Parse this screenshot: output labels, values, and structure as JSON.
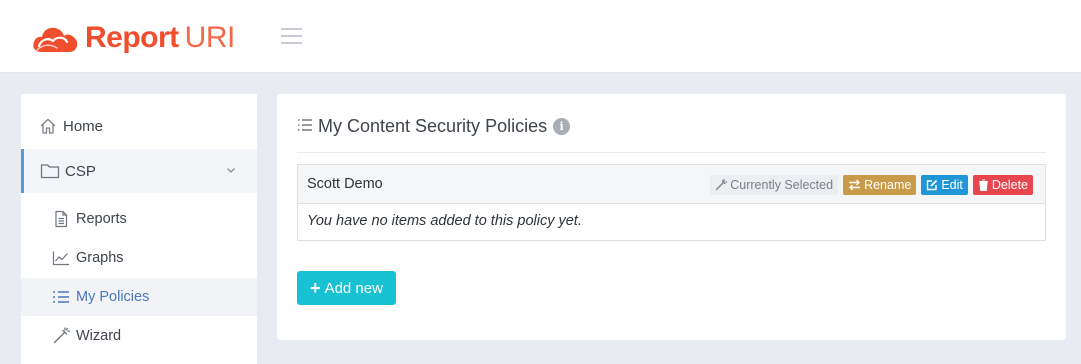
{
  "brand": {
    "name_part1": "Report",
    "name_part2": "URI",
    "primary_color": "#f04e2c"
  },
  "header": {
    "menu_icon": "hamburger-icon"
  },
  "sidebar": {
    "items": [
      {
        "label": "Home",
        "icon": "home-icon"
      },
      {
        "label": "CSP",
        "icon": "folder-icon",
        "expanded": true
      },
      {
        "label": "Reports",
        "icon": "document-icon"
      },
      {
        "label": "Graphs",
        "icon": "chart-icon"
      },
      {
        "label": "My Policies",
        "icon": "list-icon",
        "active": true
      },
      {
        "label": "Wizard",
        "icon": "magic-wand-icon"
      }
    ]
  },
  "main": {
    "title": "My Content Security Policies",
    "info_icon": "info-icon",
    "policy": {
      "name": "Scott Demo",
      "status_label": "Currently Selected",
      "rename_label": "Rename",
      "edit_label": "Edit",
      "delete_label": "Delete",
      "empty_message": "You have no items added to this policy yet."
    },
    "add_label": "Add new"
  },
  "colors": {
    "accent": "#18c2d3",
    "rename": "#c89a4a",
    "edit": "#2196d6",
    "delete": "#e8464f",
    "active_nav": "#5b9bd5"
  }
}
